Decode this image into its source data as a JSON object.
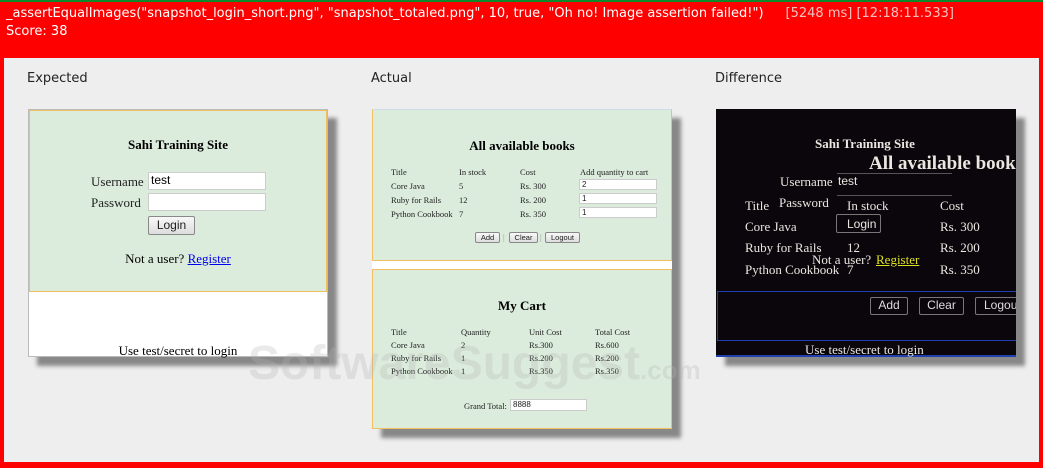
{
  "header": {
    "assertion": "_assertEqualImages(\"snapshot_login_short.png\", \"snapshot_totaled.png\", 10, true, \"Oh no! Image assertion failed!\")",
    "timing": "[5248 ms] [12:18:11.533]",
    "score": "Score: 38"
  },
  "labels": {
    "expected": "Expected",
    "actual": "Actual",
    "difference": "Difference"
  },
  "login": {
    "title": "Sahi Training Site",
    "username_label": "Username",
    "username_value": "test",
    "password_label": "Password",
    "login_button": "Login",
    "not_user": "Not a user?",
    "register": "Register",
    "hint": "Use test/secret to login"
  },
  "books": {
    "title": "All available books",
    "headers": [
      "Title",
      "In stock",
      "Cost",
      "Add quantity to cart"
    ],
    "rows": [
      {
        "title": "Core Java",
        "stock": "5",
        "cost": "Rs. 300",
        "qty": "2"
      },
      {
        "title": "Ruby for Rails",
        "stock": "12",
        "cost": "Rs. 200",
        "qty": "1"
      },
      {
        "title": "Python Cookbook",
        "stock": "7",
        "cost": "Rs. 350",
        "qty": "1"
      }
    ],
    "add": "Add",
    "clear": "Clear",
    "logout": "Logout",
    "sep": "|"
  },
  "cart": {
    "title": "My Cart",
    "headers": [
      "Title",
      "Quantity",
      "Unit Cost",
      "Total Cost"
    ],
    "rows": [
      {
        "title": "Core Java",
        "qty": "2",
        "unit": "Rs.300",
        "total": "Rs.600"
      },
      {
        "title": "Ruby for Rails",
        "qty": "1",
        "unit": "Rs.200",
        "total": "Rs.200"
      },
      {
        "title": "Python Cookbook",
        "qty": "1",
        "unit": "Rs.350",
        "total": "Rs.350"
      }
    ],
    "grand_total_label": "Grand Total:",
    "grand_total_value": "8888"
  },
  "diff": {
    "books_title_partial": "All available book",
    "logout_partial": "Logou"
  },
  "watermark": {
    "text": "SoftwareSuggest",
    "suffix": ".com"
  }
}
